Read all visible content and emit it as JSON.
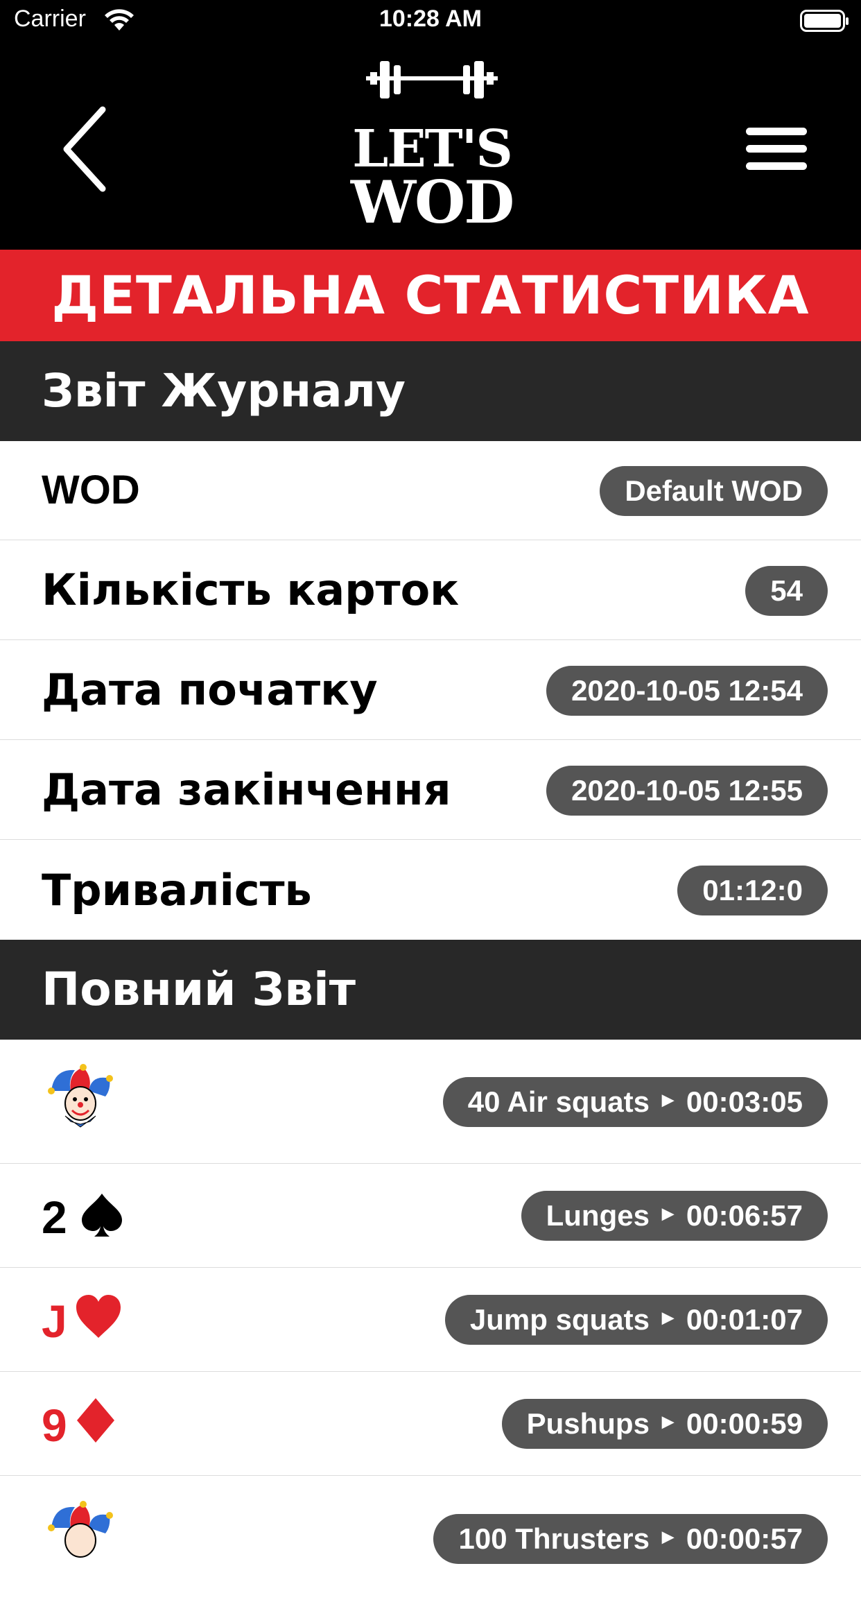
{
  "status_bar": {
    "carrier": "Carrier",
    "time": "10:28 AM"
  },
  "header": {
    "logo_line1": "LET'S",
    "logo_line2": "WOD",
    "back_icon": "chevron-left-icon",
    "menu_icon": "hamburger-icon"
  },
  "banner": {
    "title": "ДЕТАЛЬНА СТАТИСТИКА",
    "color": "#e3232b"
  },
  "journal": {
    "title": "Звіт Журналу",
    "rows": [
      {
        "label": "WOD",
        "value": "Default WOD"
      },
      {
        "label": "Кількість карток",
        "value": "54"
      },
      {
        "label": "Дата початку",
        "value": "2020-10-05 12:54"
      },
      {
        "label": "Дата закінчення",
        "value": "2020-10-05 12:55"
      },
      {
        "label": "Тривалість",
        "value": "01:12:0"
      }
    ]
  },
  "full_report": {
    "title": "Повний Звіт",
    "items": [
      {
        "card": "joker",
        "exercise": "40 Air squats",
        "time": "00:03:05"
      },
      {
        "card_rank": "2",
        "card_suit": "spade",
        "exercise": "Lunges",
        "time": "00:06:57"
      },
      {
        "card_rank": "J",
        "card_suit": "heart",
        "exercise": "Jump squats",
        "time": "00:01:07"
      },
      {
        "card_rank": "9",
        "card_suit": "diamond",
        "exercise": "Pushups",
        "time": "00:00:59"
      },
      {
        "card": "joker",
        "exercise": "100 Thrusters",
        "time": "00:00:57"
      }
    ]
  },
  "colors": {
    "suit_red": "#e3232b",
    "suit_black": "#000000",
    "pill_bg": "#555555",
    "section_bg": "#282828"
  }
}
